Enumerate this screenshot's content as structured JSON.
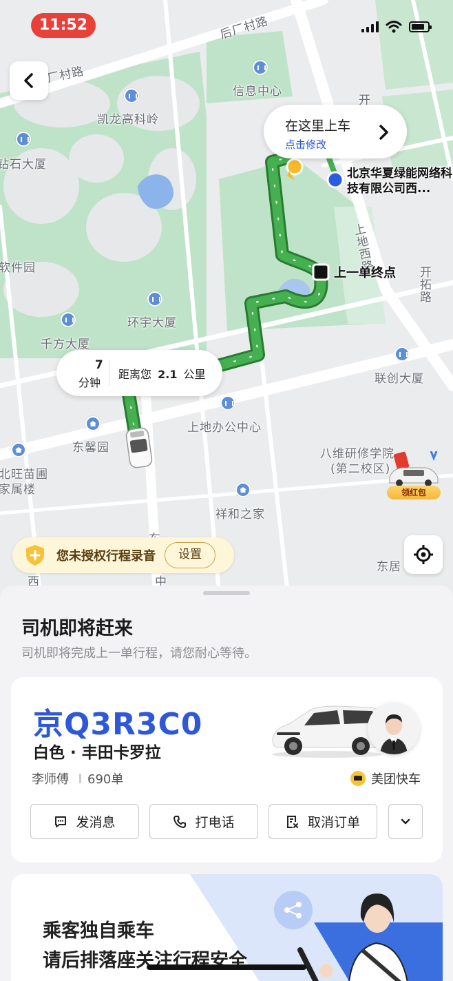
{
  "status_bar": {
    "time": "11:52"
  },
  "map": {
    "labels": {
      "road_houchang_1": "后厂村路",
      "road_houchang_2": "厂村路",
      "kailong": "凯龙高科岭",
      "xinxi": "信息中心",
      "shishi": "钻石大厦",
      "ruanjian": "软件园",
      "huanyu": "环宇大厦",
      "qianfang": "千方大厦",
      "shangdi_office": "上地办公中心",
      "dongxin": "东馨园",
      "beiwang_1": "北旺苗圃",
      "beiwang_2": "家属楼",
      "xianghe": "祥和之家",
      "bawei_1": "八维研修学院",
      "bawei_2": "(第二校区)",
      "lianchuang": "联创大厦",
      "dongju": "东居",
      "kaituo": "开拓路",
      "shangdi_road": "上地西路",
      "kai": "开",
      "xi": "西",
      "zhong": "中",
      "dong": "东",
      "company": "北京华夏绿能网络科技有限公司西...",
      "last_order_end": "上一单终点"
    },
    "hongbao_label": "领红包"
  },
  "pickup_bubble": {
    "title": "在这里上车",
    "action": "点击修改"
  },
  "eta_bubble": {
    "minutes": "7",
    "minutes_unit": "分钟",
    "distance_prefix": "距离您",
    "distance_value": "2.1",
    "distance_unit": "公里"
  },
  "record_banner": {
    "text": "您未授权行程录音",
    "button": "设置"
  },
  "sheet": {
    "title": "司机即将赶来",
    "subtitle": "司机即将完成上一单行程，请您耐心等待。"
  },
  "driver_card": {
    "plate": "京Q3R3C0",
    "car_desc": "白色 · 丰田卡罗拉",
    "driver_name": "李师傅",
    "orders": "690单",
    "service": "美团快车",
    "actions": {
      "message": "发消息",
      "call": "打电话",
      "cancel": "取消订单"
    }
  },
  "safety_card": {
    "line1": "乘客独自乘车",
    "line2": "请后排落座关注行程安全"
  },
  "colors": {
    "accent_blue": "#2f58d6",
    "route_green": "#3fa04a",
    "time_red": "#e8413a"
  }
}
